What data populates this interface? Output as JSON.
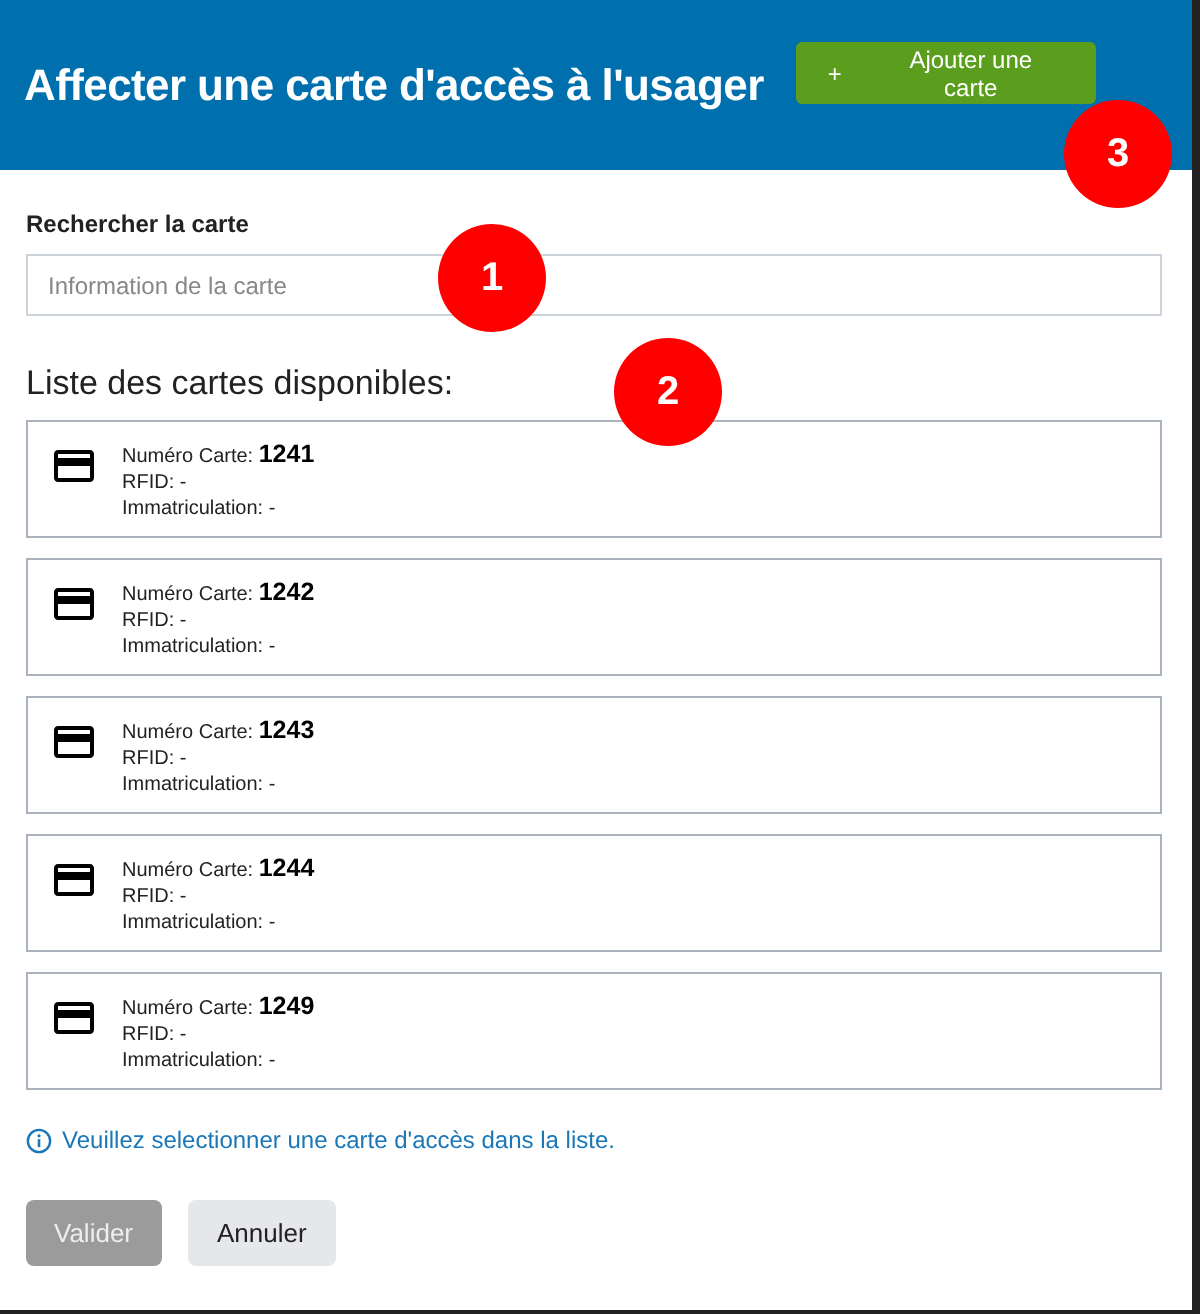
{
  "dialog": {
    "title": "Affecter une carte d'accès à l'usager",
    "add_button": {
      "icon": "+",
      "label": "Ajouter une carte"
    }
  },
  "search": {
    "label": "Rechercher la carte",
    "placeholder": "Information de la carte"
  },
  "list_title": "Liste des cartes disponibles:",
  "cards": [
    {
      "number_label": "Numéro Carte:",
      "number": "1241",
      "rfid_label": "RFID:",
      "rfid": "-",
      "plate_label": "Immatriculation:",
      "plate": "-",
      "selected": false
    },
    {
      "number_label": "Numéro Carte:",
      "number": "1242",
      "rfid_label": "RFID:",
      "rfid": "-",
      "plate_label": "Immatriculation:",
      "plate": "-",
      "selected": false
    },
    {
      "number_label": "Numéro Carte:",
      "number": "1243",
      "rfid_label": "RFID:",
      "rfid": "-",
      "plate_label": "Immatriculation:",
      "plate": "-",
      "selected": false
    },
    {
      "number_label": "Numéro Carte:",
      "number": "1244",
      "rfid_label": "RFID:",
      "rfid": "-",
      "plate_label": "Immatriculation:",
      "plate": "-",
      "selected": false
    },
    {
      "number_label": "Numéro Carte:",
      "number": "1249",
      "rfid_label": "RFID:",
      "rfid": "-",
      "plate_label": "Immatriculation:",
      "plate": "-",
      "selected": false
    }
  ],
  "info_message": "Veuillez selectionner une carte d'accès dans la liste.",
  "buttons": [
    {
      "label": "Valider",
      "kind": "primary",
      "disabled": true
    },
    {
      "label": "Annuler",
      "kind": "secondary",
      "disabled": false
    }
  ],
  "callouts": [
    {
      "label": "1"
    },
    {
      "label": "2"
    },
    {
      "label": "3"
    }
  ]
}
